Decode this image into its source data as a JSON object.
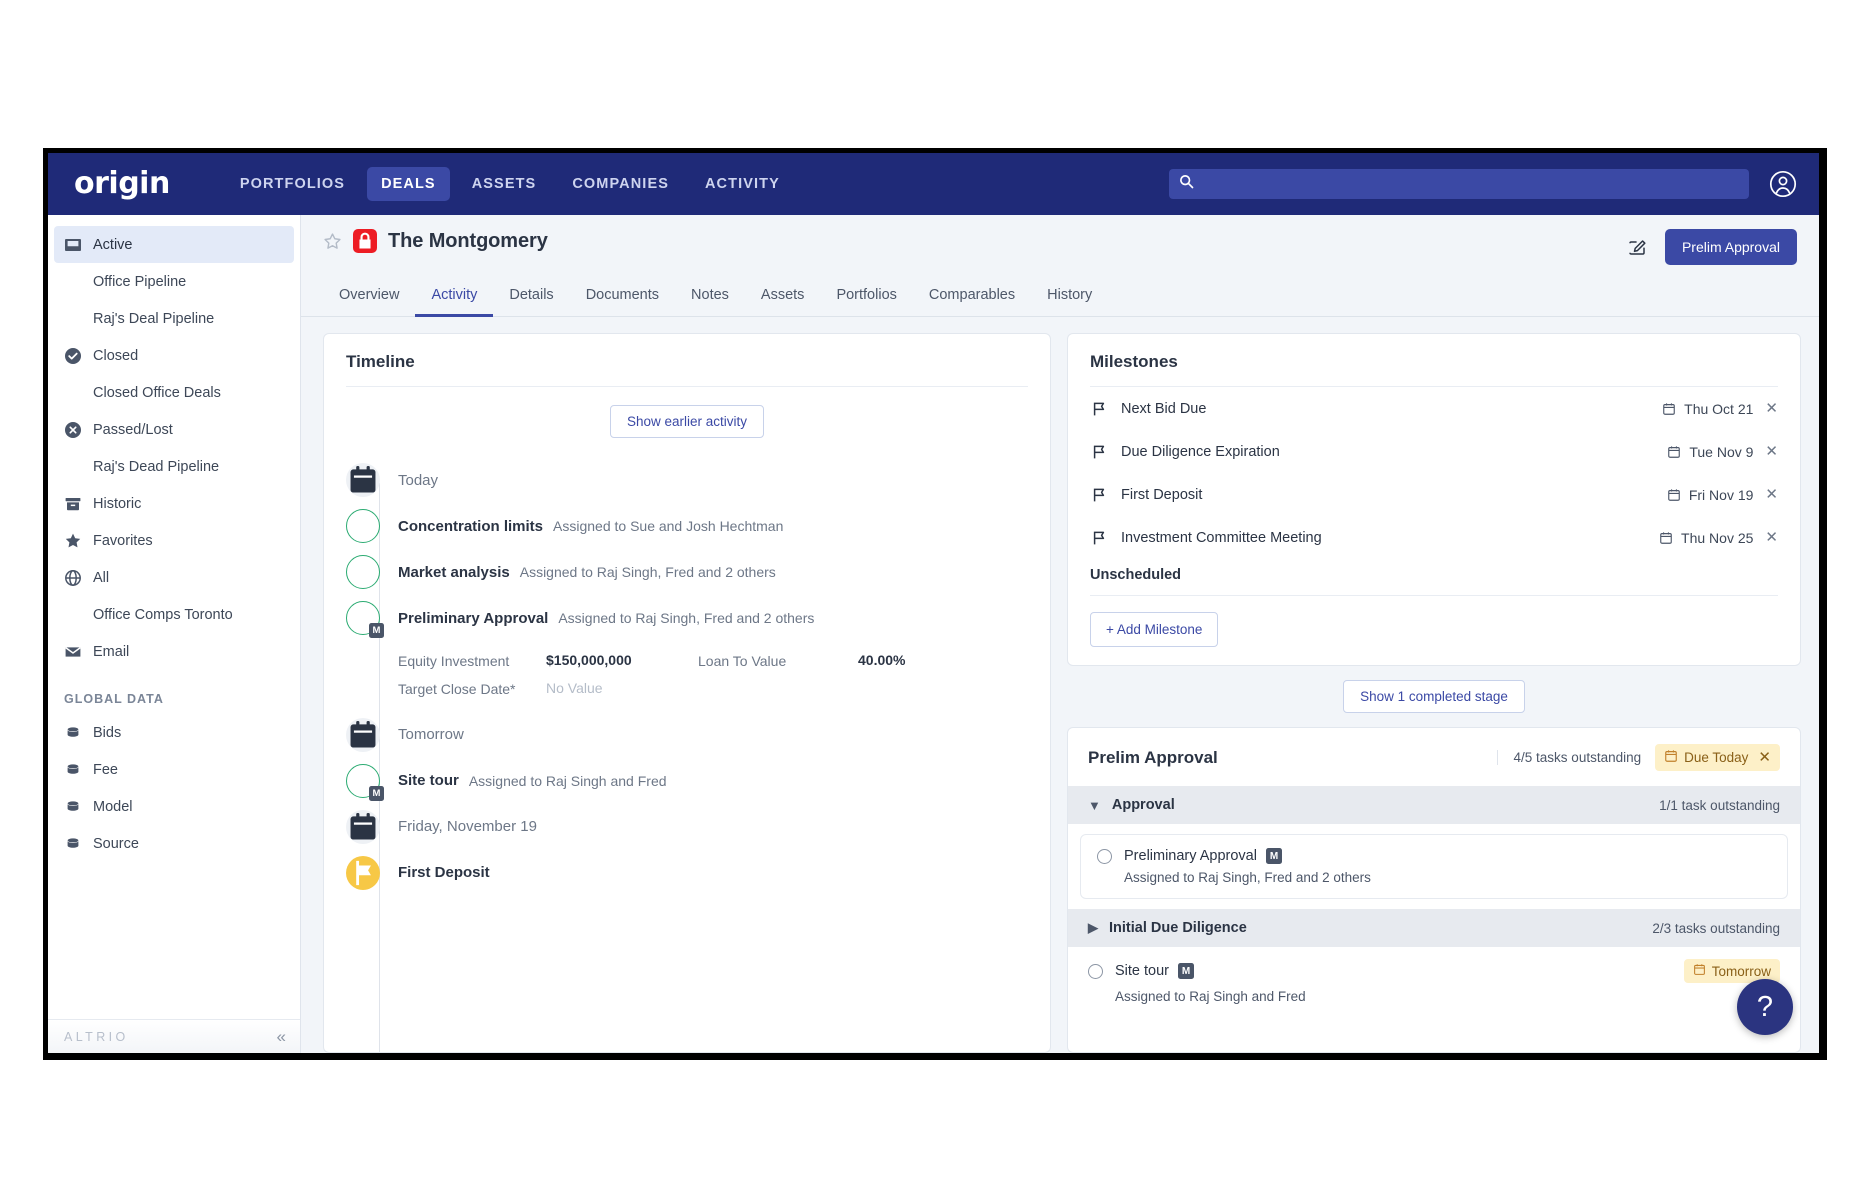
{
  "topnav": {
    "logo": "origin",
    "items": [
      {
        "label": "PORTFOLIOS",
        "active": false
      },
      {
        "label": "DEALS",
        "active": true
      },
      {
        "label": "ASSETS",
        "active": false
      },
      {
        "label": "COMPANIES",
        "active": false
      },
      {
        "label": "ACTIVITY",
        "active": false
      }
    ],
    "search_placeholder": "",
    "search_value": "",
    "search_icon": "search-icon",
    "avatar_icon": "user-avatar-icon"
  },
  "sidebar": {
    "items": [
      {
        "label": "Active",
        "icon": "inbox-icon",
        "sub": false,
        "active": true
      },
      {
        "label": "Office Pipeline",
        "icon": "",
        "sub": true,
        "active": false
      },
      {
        "label": "Raj's Deal Pipeline",
        "icon": "",
        "sub": true,
        "active": false
      },
      {
        "label": "Closed",
        "icon": "check-circle-icon",
        "sub": false,
        "active": false
      },
      {
        "label": "Closed Office Deals",
        "icon": "",
        "sub": true,
        "active": false
      },
      {
        "label": "Passed/Lost",
        "icon": "x-circle-icon",
        "sub": false,
        "active": false
      },
      {
        "label": "Raj's Dead Pipeline",
        "icon": "",
        "sub": true,
        "active": false
      },
      {
        "label": "Historic",
        "icon": "archive-icon",
        "sub": false,
        "active": false
      },
      {
        "label": "Favorites",
        "icon": "star-icon",
        "sub": false,
        "active": false
      },
      {
        "label": "All",
        "icon": "globe-icon",
        "sub": false,
        "active": false
      },
      {
        "label": "Office Comps Toronto",
        "icon": "",
        "sub": true,
        "active": false
      },
      {
        "label": "Email",
        "icon": "envelope-icon",
        "sub": false,
        "active": false
      }
    ],
    "group_label": "GLOBAL DATA",
    "global_items": [
      {
        "label": "Bids",
        "icon": "database-icon"
      },
      {
        "label": "Fee",
        "icon": "database-icon"
      },
      {
        "label": "Model",
        "icon": "database-icon"
      },
      {
        "label": "Source",
        "icon": "database-icon"
      }
    ],
    "footer_brand": "ALTRIO",
    "collapse_icon": "double-chevron-left-icon"
  },
  "page": {
    "title": "The Montgomery",
    "star_icon": "star-outline-icon",
    "lock_icon": "lock-icon",
    "edit_icon": "edit-pencil-icon",
    "action_button": "Prelim Approval",
    "tabs": [
      {
        "label": "Overview",
        "active": false
      },
      {
        "label": "Activity",
        "active": true
      },
      {
        "label": "Details",
        "active": false
      },
      {
        "label": "Documents",
        "active": false
      },
      {
        "label": "Notes",
        "active": false
      },
      {
        "label": "Assets",
        "active": false
      },
      {
        "label": "Portfolios",
        "active": false
      },
      {
        "label": "Comparables",
        "active": false
      },
      {
        "label": "History",
        "active": false
      }
    ]
  },
  "timeline": {
    "title": "Timeline",
    "show_earlier_button": "Show earlier activity",
    "entries": [
      {
        "kind": "date",
        "label": "Today",
        "icon": "calendar-icon"
      },
      {
        "kind": "task",
        "name": "Concentration limits",
        "assigned": "Assigned to Sue and Josh Hechtman",
        "badge": ""
      },
      {
        "kind": "task",
        "name": "Market analysis",
        "assigned": "Assigned to Raj Singh, Fred and 2 others",
        "badge": ""
      },
      {
        "kind": "task",
        "name": "Preliminary Approval",
        "assigned": "Assigned to Raj Singh, Fred and 2 others",
        "badge": "M"
      },
      {
        "kind": "date",
        "label": "Tomorrow",
        "icon": "calendar-icon"
      },
      {
        "kind": "task",
        "name": "Site tour",
        "assigned": "Assigned to Raj Singh and Fred",
        "badge": "M"
      },
      {
        "kind": "date",
        "label": "Friday, November 19",
        "icon": "calendar-icon"
      },
      {
        "kind": "milestone",
        "name": "First Deposit",
        "assigned": "",
        "badge": ""
      }
    ],
    "details": {
      "equity_label": "Equity Investment",
      "equity_value": "$150,000,000",
      "ltv_label": "Loan To Value",
      "ltv_value": "40.00%",
      "target_label": "Target Close Date*",
      "target_value": "No Value"
    }
  },
  "milestones": {
    "title": "Milestones",
    "rows": [
      {
        "name": "Next Bid Due",
        "date": "Thu Oct 21"
      },
      {
        "name": "Due Diligence Expiration",
        "date": "Tue Nov 9"
      },
      {
        "name": "First Deposit",
        "date": "Fri Nov 19"
      },
      {
        "name": "Investment Committee Meeting",
        "date": "Thu Nov 25"
      }
    ],
    "unscheduled_label": "Unscheduled",
    "add_button": "+ Add Milestone",
    "flag_icon": "flag-icon",
    "calendar_icon": "calendar-icon",
    "close_icon": "close-icon"
  },
  "show_completed_stage_button": "Show 1 completed stage",
  "prelim": {
    "title": "Prelim Approval",
    "tasks_outstanding": "4/5 tasks outstanding",
    "due_pill": "Due Today",
    "stages": [
      {
        "name": "Approval",
        "count": "1/1 task outstanding",
        "expanded": true,
        "chevron": "chevron-down-icon",
        "task": {
          "name": "Preliminary Approval",
          "badge": "M",
          "assigned": "Assigned to Raj Singh, Fred and 2 others",
          "due": ""
        }
      },
      {
        "name": "Initial Due Diligence",
        "count": "2/3 tasks outstanding",
        "expanded": false,
        "chevron": "chevron-right-icon",
        "task": {
          "name": "Site tour",
          "badge": "M",
          "assigned": "Assigned to Raj Singh and Fred",
          "due": "Tomorrow"
        }
      }
    ]
  },
  "help_button": "?"
}
